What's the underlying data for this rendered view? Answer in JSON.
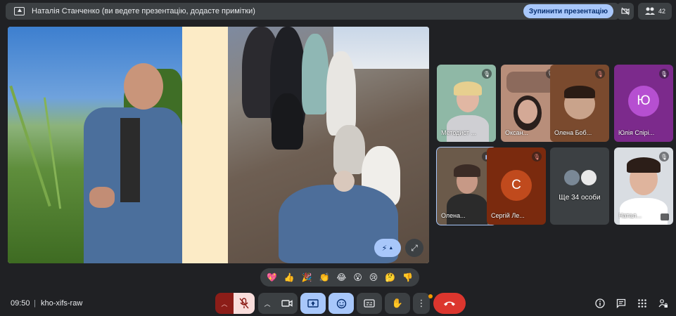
{
  "header": {
    "presenting_text": "Наталія Станченко (ви ведете презентацію, додасте примітки)",
    "stop_button_label": "Зупинити презентацію",
    "people_count": "42"
  },
  "participants": [
    {
      "name": "Методист ...",
      "muted": true
    },
    {
      "name": "Оксан...",
      "muted": true
    },
    {
      "name": "Олена Боб...",
      "muted": true
    },
    {
      "name": "Юлія Спірі...",
      "muted": true,
      "initial": "Ю",
      "avatar_color": "#b64fd1"
    },
    {
      "name": "Олена...",
      "muted": false,
      "speaking": true
    },
    {
      "name": "Сергій Ле...",
      "muted": true,
      "initial": "С",
      "avatar_color": "#c04a1d"
    },
    {
      "name": "Ще 34 особи"
    },
    {
      "name": "Натал...",
      "muted": true
    }
  ],
  "reactions": [
    "💖",
    "👍",
    "🎉",
    "👏",
    "😂",
    "😮",
    "😢",
    "🤔",
    "👎"
  ],
  "footer": {
    "time": "09:50",
    "separator": "|",
    "meeting_code": "kho-xifs-raw"
  },
  "colors": {
    "background": "#202124",
    "accent_blue": "#a8c7fa",
    "hangup_red": "#dc362e"
  }
}
